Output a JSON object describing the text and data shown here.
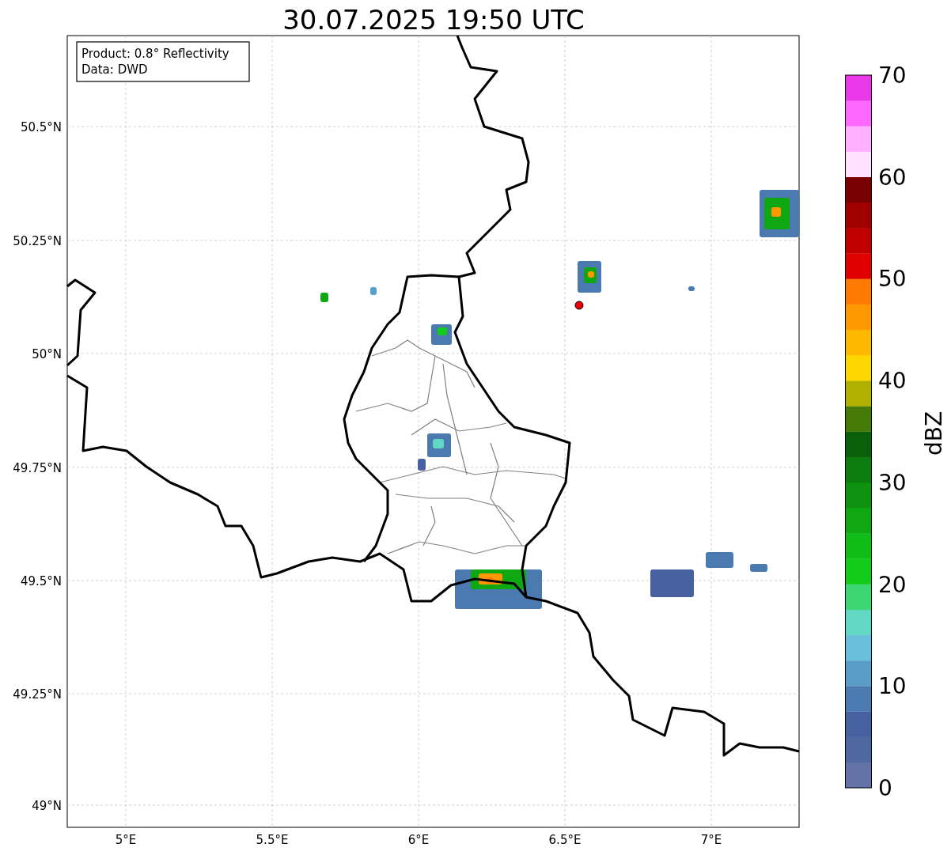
{
  "title": "30.07.2025 19:50 UTC",
  "info_box": [
    "Product: 0.8° Reflectivity",
    "Data: DWD"
  ],
  "x_ticks": [
    "5°E",
    "5.5°E",
    "6°E",
    "6.5°E",
    "7°E"
  ],
  "y_ticks": [
    "50.5°N",
    "50.25°N",
    "50°N",
    "49.75°N",
    "49.5°N",
    "49.25°N",
    "49°N"
  ],
  "colorbar": {
    "label": "dBZ",
    "ticks": [
      "70",
      "60",
      "50",
      "40",
      "30",
      "20",
      "10",
      "0"
    ],
    "segments": [
      {
        "color": "#6373a8"
      },
      {
        "color": "#5068a0"
      },
      {
        "color": "#4660a0"
      },
      {
        "color": "#4a7ab0"
      },
      {
        "color": "#5a9ec8"
      },
      {
        "color": "#68c0dc"
      },
      {
        "color": "#63d8c4"
      },
      {
        "color": "#3cd672"
      },
      {
        "color": "#13cc1a"
      },
      {
        "color": "#10bc18"
      },
      {
        "color": "#0fa812"
      },
      {
        "color": "#0e9210"
      },
      {
        "color": "#0c7c0e"
      },
      {
        "color": "#0a600a"
      },
      {
        "color": "#467a08"
      },
      {
        "color": "#b0b000"
      },
      {
        "color": "#ffd700"
      },
      {
        "color": "#ffb800"
      },
      {
        "color": "#ff9800"
      },
      {
        "color": "#ff7a00"
      },
      {
        "color": "#e00000"
      },
      {
        "color": "#c00000"
      },
      {
        "color": "#a00000"
      },
      {
        "color": "#780000"
      },
      {
        "color": "#ffe0ff"
      },
      {
        "color": "#ffb0ff"
      },
      {
        "color": "#ff68ff"
      },
      {
        "color": "#e838e8"
      }
    ]
  }
}
